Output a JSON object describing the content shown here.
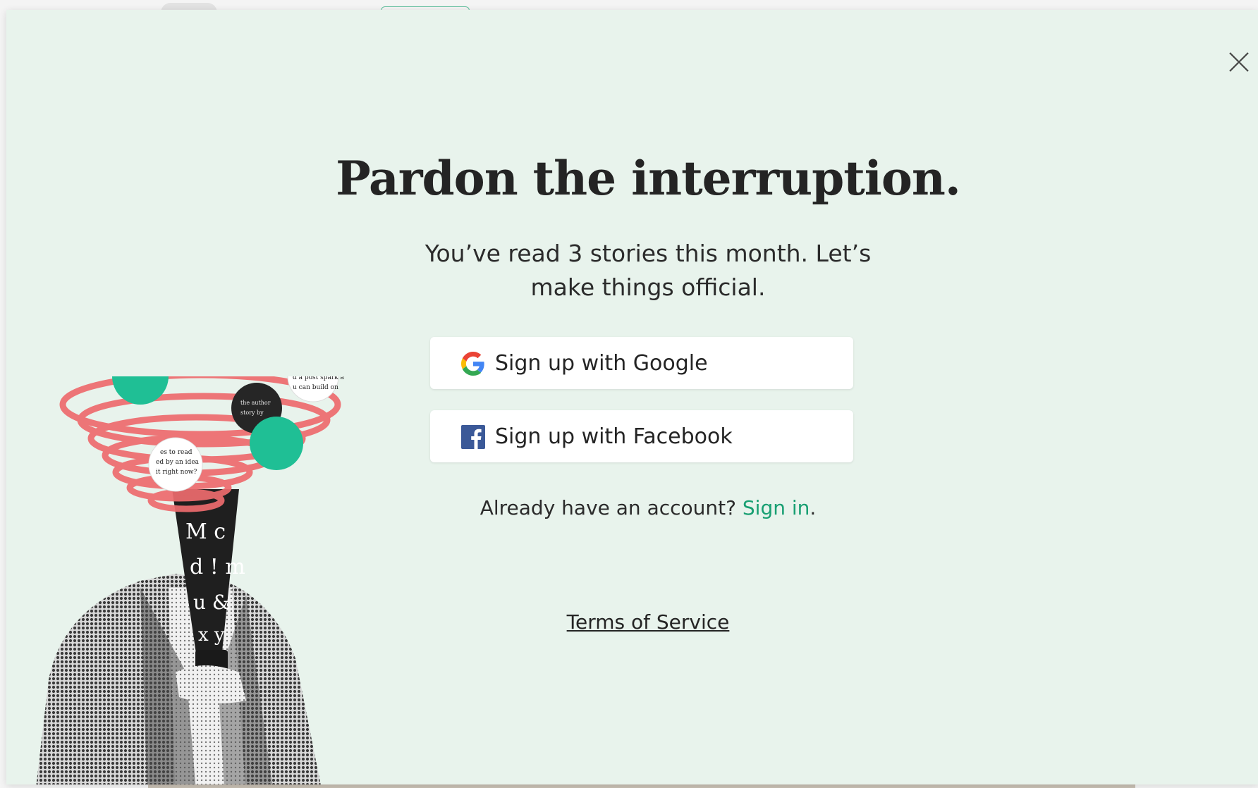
{
  "modal": {
    "title": "Pardon the interruption.",
    "subtitle": "You’ve read 3 stories this month. Let’s make things official.",
    "google_button_label": "Sign up with Google",
    "facebook_button_label": "Sign up with Facebook",
    "signin_prompt": "Already have an account? ",
    "signin_link": "Sign in",
    "signin_period": ".",
    "terms_link": "Terms of Service"
  },
  "icons": {
    "close": "close-icon",
    "google": "google-icon",
    "facebook": "facebook-icon"
  },
  "colors": {
    "modal_background": "#e8f3ec",
    "accent_green": "#189f72",
    "text_dark": "#242424",
    "swirl_red": "#ee6b6e",
    "circle_teal": "#1fbf95"
  }
}
